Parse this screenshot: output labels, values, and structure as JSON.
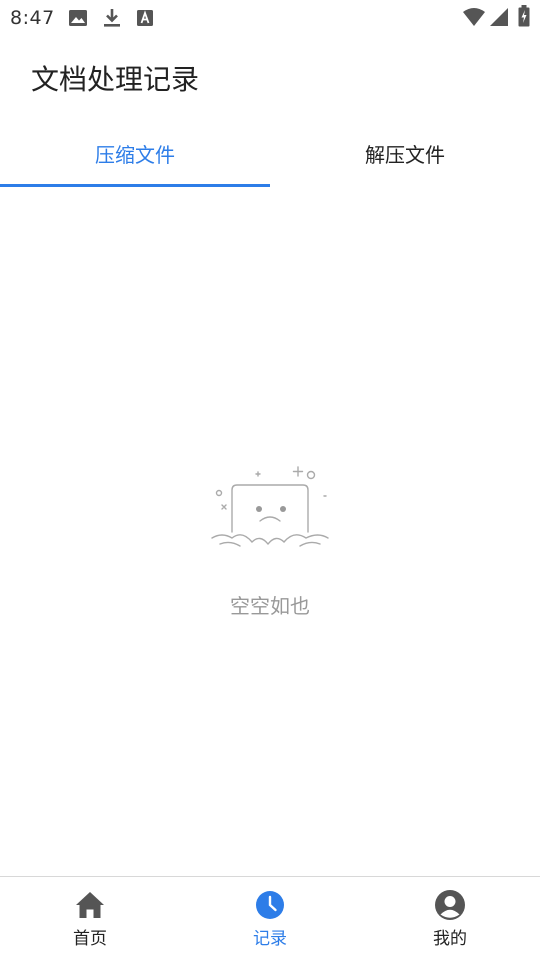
{
  "status_bar": {
    "time": "8:47",
    "left_icons": [
      "image-icon",
      "download-icon",
      "keyboard-a-icon"
    ],
    "right_icons": [
      "wifi-icon",
      "signal-icon",
      "battery-icon"
    ]
  },
  "header": {
    "title": "文档处理记录"
  },
  "tabs": [
    {
      "label": "压缩文件",
      "active": true
    },
    {
      "label": "解压文件",
      "active": false
    }
  ],
  "empty_state": {
    "icon": "empty-box-sad-icon",
    "text": "空空如也"
  },
  "bottom_nav": [
    {
      "label": "首页",
      "icon": "home-icon",
      "active": false
    },
    {
      "label": "记录",
      "icon": "clock-icon",
      "active": true
    },
    {
      "label": "我的",
      "icon": "user-icon",
      "active": false
    }
  ],
  "colors": {
    "accent": "#2d7de8",
    "text": "#222222",
    "muted": "#999999",
    "divider": "#d8d8d8"
  }
}
